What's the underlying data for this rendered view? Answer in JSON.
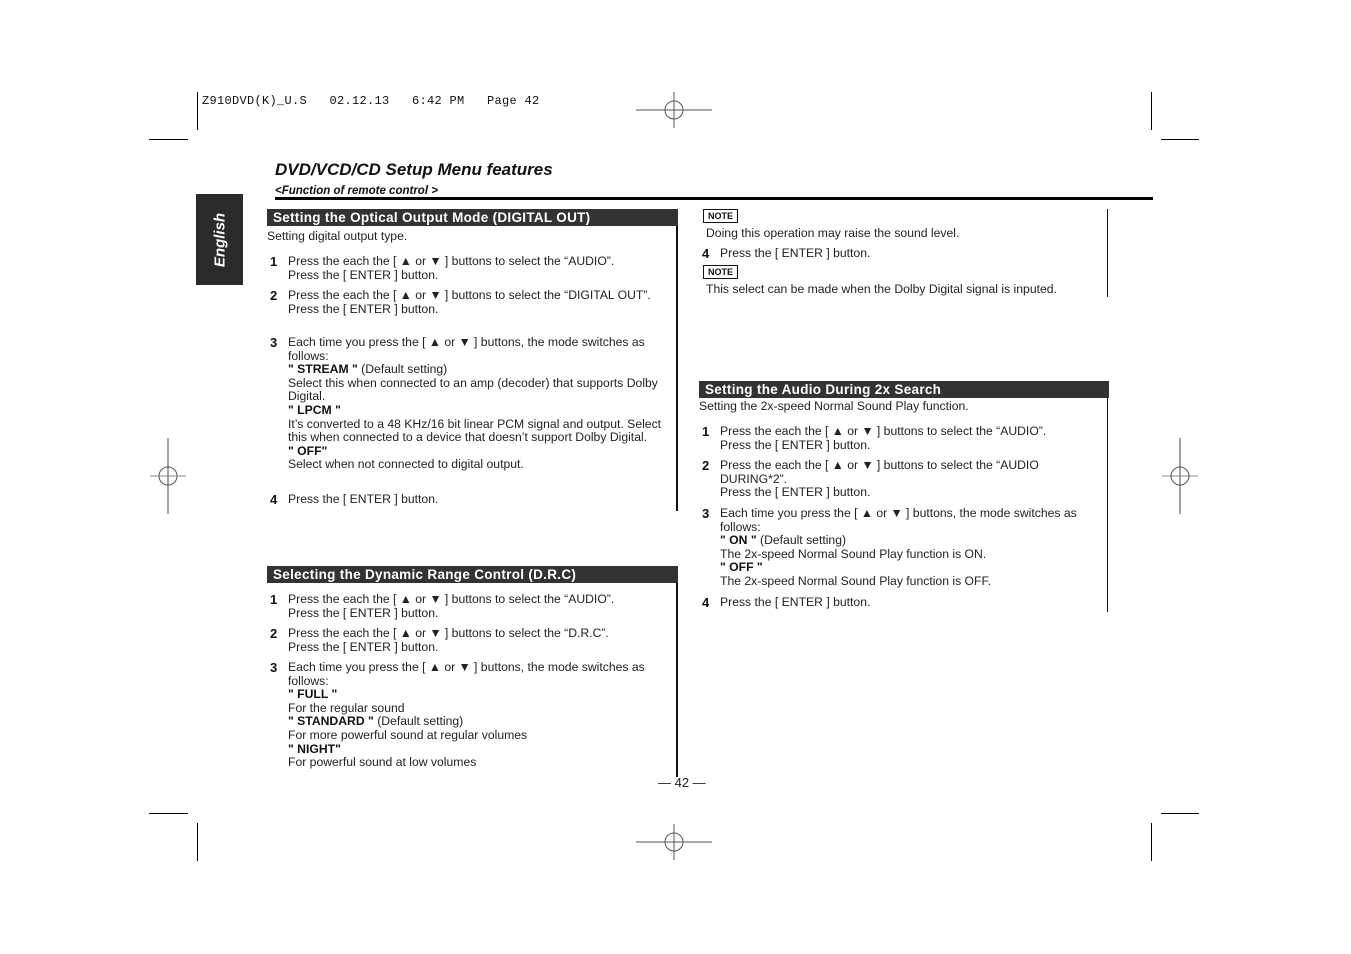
{
  "slug": "Z910DVD(K)_U.S   02.12.13   6:42 PM   Page 42",
  "header": {
    "title": "DVD/VCD/CD Setup Menu features",
    "subtitle": "<Function of remote control >"
  },
  "language_tab": "English",
  "sections": {
    "optical": {
      "heading": "Setting the Optical Output Mode (DIGITAL OUT)",
      "intro": "Setting digital output type.",
      "steps": [
        {
          "num": "1",
          "line1": "Press the each the [ ▲  or  ▼ ] buttons to select the “AUDIO”.",
          "line2": "Press the [ ENTER ] button."
        },
        {
          "num": "2",
          "line1": "Press the each the [ ▲  or  ▼ ] buttons to select the “DIGITAL OUT”.",
          "line2": "Press the [ ENTER ] button."
        },
        {
          "num": "3",
          "line1": "Each time you press the [ ▲  or  ▼ ] buttons, the mode switches as follows:"
        },
        {
          "num": "4",
          "line1": "Press the [ ENTER ] button."
        }
      ],
      "options": [
        {
          "label": "\" STREAM \"",
          "suffix": " (Default setting)",
          "desc": "Select this when connected to an amp (decoder) that supports Dolby Digital."
        },
        {
          "label": "\" LPCM \"",
          "suffix": "",
          "desc": "It’s converted to a 48 KHz/16 bit linear PCM signal and output. Select this when connected to a device that doesn’t support Dolby Digital."
        },
        {
          "label": "\" OFF\"",
          "suffix": "",
          "desc": "Select when not connected to digital output."
        }
      ]
    },
    "drc": {
      "heading": "Selecting the Dynamic Range Control (D.R.C)",
      "steps": [
        {
          "num": "1",
          "line1": "Press the each the [ ▲  or  ▼ ] buttons to select the “AUDIO”.",
          "line2": "Press the [ ENTER ] button."
        },
        {
          "num": "2",
          "line1": "Press the each the [ ▲  or  ▼ ] buttons to select the “D.R.C”.",
          "line2": "Press the [ ENTER ] button."
        },
        {
          "num": "3",
          "line1": "Each time you press the [ ▲  or  ▼ ] buttons, the mode switches as follows:"
        }
      ],
      "options": [
        {
          "label": "\" FULL \"",
          "suffix": "",
          "desc": "For the regular sound"
        },
        {
          "label": "\" STANDARD \"",
          "suffix": " (Default setting)",
          "desc": "For more powerful sound at regular volumes"
        },
        {
          "label": "\" NIGHT\"",
          "suffix": "",
          "desc": "For powerful sound at low volumes"
        }
      ]
    },
    "continued": {
      "note1_badge": "NOTE",
      "note1_text": "Doing this operation may raise the sound level.",
      "step4_num": "4",
      "step4_text": "Press the [ ENTER ] button.",
      "note2_badge": "NOTE",
      "note2_text": "This select can be made when the Dolby Digital signal is inputed."
    },
    "search2x": {
      "heading": "Setting the Audio During 2x Search",
      "intro": "Setting the 2x-speed Normal Sound Play function.",
      "steps": [
        {
          "num": "1",
          "line1": "Press the each the [ ▲  or  ▼ ] buttons to select the “AUDIO”.",
          "line2": "Press the [ ENTER ] button."
        },
        {
          "num": "2",
          "line1": "Press the each the [ ▲  or  ▼ ] buttons to select the “AUDIO DURING*2”.",
          "line2": "Press the [ ENTER ] button."
        },
        {
          "num": "3",
          "line1": "Each time you press the [ ▲  or  ▼ ] buttons, the mode switches as follows:"
        },
        {
          "num": "4",
          "line1": "Press the [ ENTER ] button."
        }
      ],
      "options": [
        {
          "label": "\" ON \"",
          "suffix": " (Default setting)",
          "desc": "The 2x-speed Normal Sound Play function is ON."
        },
        {
          "label": "\" OFF \"",
          "suffix": "",
          "desc": "The 2x-speed Normal Sound Play function is OFF."
        }
      ]
    }
  },
  "page_number": "— 42 —"
}
